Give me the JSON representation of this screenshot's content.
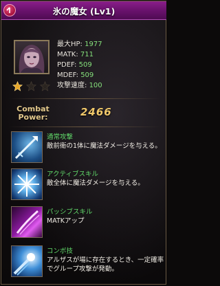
{
  "window": {
    "title": "氷の魔女 (Lv1)"
  },
  "stats": [
    {
      "label": "最大HP:",
      "value": "1977"
    },
    {
      "label": "MATK:",
      "value": "711"
    },
    {
      "label": "PDEF:",
      "value": "509"
    },
    {
      "label": "MDEF:",
      "value": "509"
    },
    {
      "label": "攻撃速度:",
      "value": "100"
    }
  ],
  "rating": {
    "filled": 1,
    "total": 3
  },
  "combat_power": {
    "label_line1": "Combat",
    "label_line2": "Power:",
    "value": "2466"
  },
  "skills": [
    {
      "type": "通常攻撃",
      "description": "敵前衛の1体に魔法ダメージを与える。",
      "icon": "ice-spear-icon"
    },
    {
      "type": "アクティブスキル",
      "description": "敵全体に魔法ダメージを与える。",
      "icon": "ice-burst-icon"
    },
    {
      "type": "パッシブスキル",
      "description": "MATKアップ",
      "icon": "magic-slash-icon"
    },
    {
      "type": "コンボ技",
      "description": "アルザスが場に存在するとき、一定確率でグループ攻撃が発動。",
      "icon": "combo-comet-icon"
    }
  ],
  "colors": {
    "header": "#6a126d",
    "stat_value": "#86e17c",
    "skill_type": "#61d96a",
    "combat_value": "#f0c86a"
  }
}
